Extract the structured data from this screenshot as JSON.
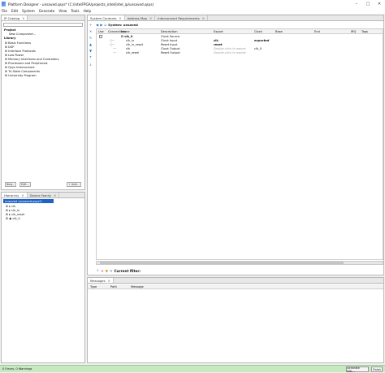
{
  "window": {
    "title": "Platform Designer - unsaved.qsys* (C:/intelFPGA/projects_intel/intel_ip/unsaved.qsys)"
  },
  "menu": [
    "File",
    "Edit",
    "System",
    "Generate",
    "View",
    "Tools",
    "Help"
  ],
  "ip_catalog": {
    "tab_label": "IP Catalog",
    "search_placeholder": "",
    "project_label": "Project",
    "new_component": "New Component...",
    "library_label": "Library",
    "library_items": [
      "Basic Functions",
      "DSP",
      "Interface Protocols",
      "Low Power",
      "Memory Interfaces and Controllers",
      "Processors and Peripherals",
      "Qsys Interconnect",
      "Tri-State Components",
      "University Program"
    ],
    "new_btn": "New...",
    "edit_btn": "Edit...",
    "add_btn": "+ Add..."
  },
  "hierarchy": {
    "tabs": [
      "Hierarchy",
      "Device Family"
    ],
    "root": "unsaved (unsaved.qsys*)",
    "items": [
      "clk",
      "clk_in",
      "clk_reset",
      "clk_0"
    ]
  },
  "system_contents": {
    "tabs": [
      "System Contents",
      "Address Map",
      "Interconnect Requirements"
    ],
    "system_label": "System: unsaved",
    "columns": [
      "Use",
      "Connections",
      "Name",
      "Description",
      "Export",
      "Clock",
      "Base",
      "End",
      "IRQ",
      "Tags"
    ],
    "rows": [
      {
        "name": "clk_0",
        "description": "Clock Source",
        "export": "",
        "clock": "",
        "bold": true
      },
      {
        "name": "clk_in",
        "description": "Clock Input",
        "export": "clk",
        "clock": "exported",
        "bold": false
      },
      {
        "name": "clk_in_reset",
        "description": "Reset Input",
        "export": "reset",
        "clock": "",
        "bold": false
      },
      {
        "name": "clk",
        "description": "Clock Output",
        "export": "Double-click to export",
        "clock": "clk_0",
        "bold": false
      },
      {
        "name": "clk_reset",
        "description": "Reset Output",
        "export": "Double-click to export",
        "clock": "",
        "bold": false
      }
    ],
    "filter_label": "Current filter:"
  },
  "messages": {
    "tab_label": "Messages",
    "columns": [
      "Type",
      "Path",
      "Message"
    ]
  },
  "status": {
    "text": "0 Errors, 0 Warnings",
    "generate_btn": "Generate HDL...",
    "finish_btn": "Finish"
  }
}
